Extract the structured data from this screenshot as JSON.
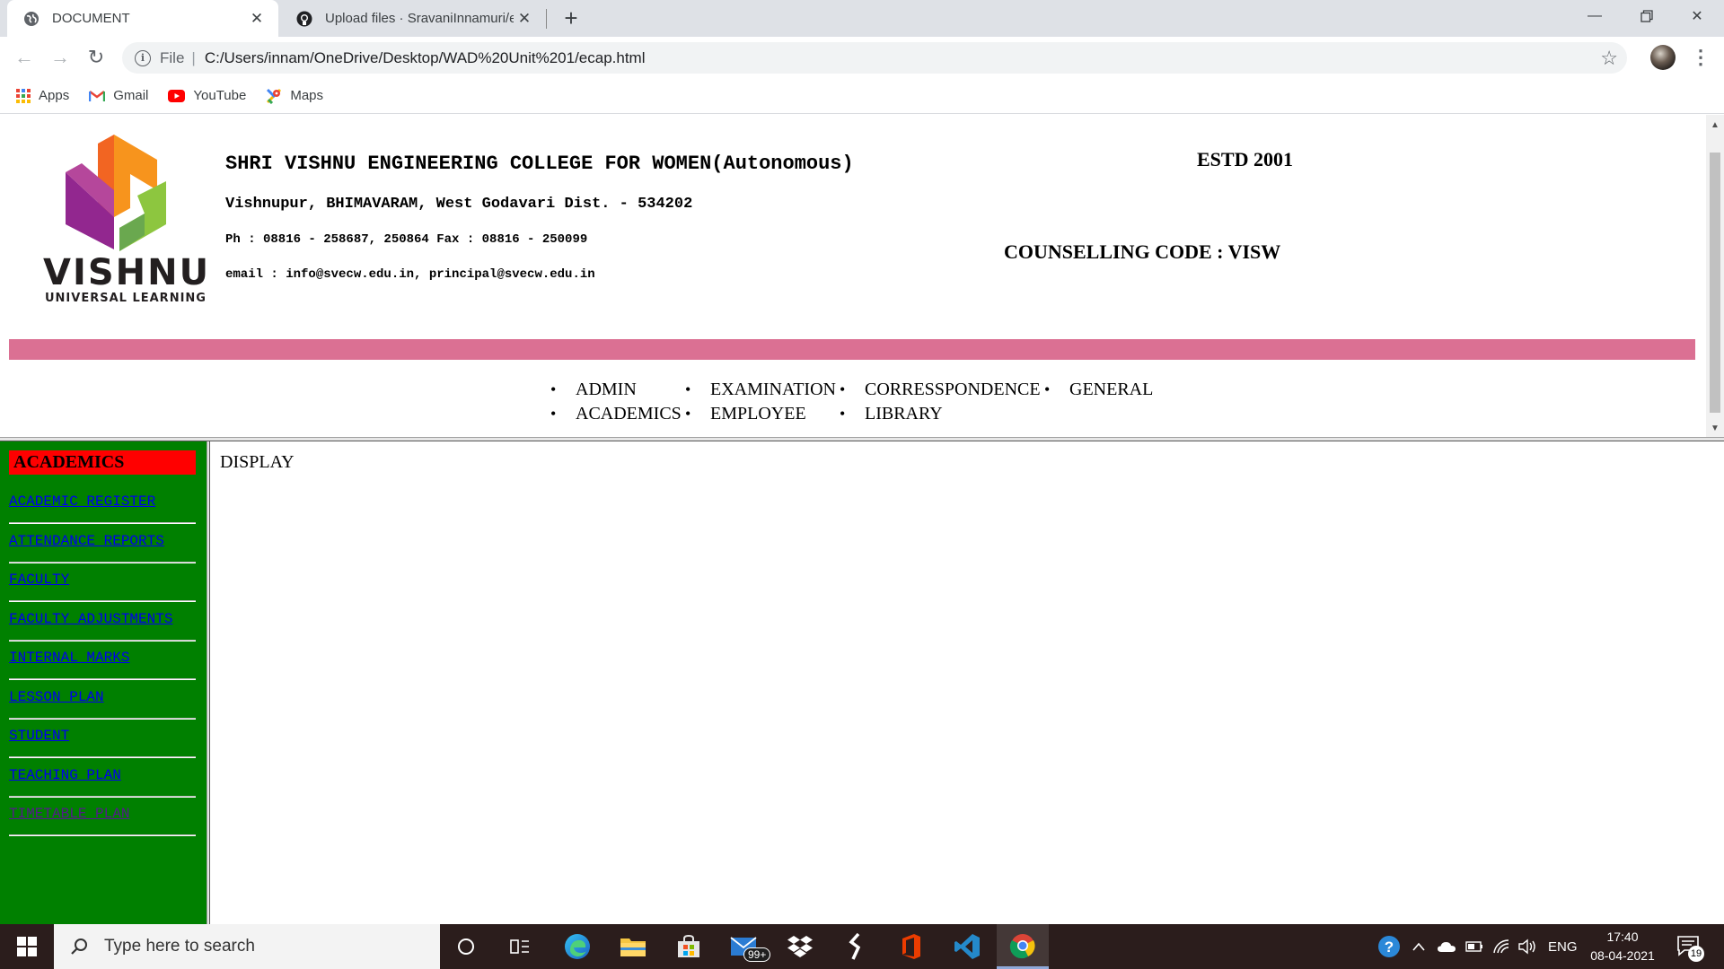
{
  "browser": {
    "tabs": [
      {
        "title": "DOCUMENT",
        "active": true
      },
      {
        "title": "Upload files · SravaniInnamuri/ec",
        "active": false
      }
    ],
    "address": {
      "scheme": "File",
      "url": "C:/Users/innam/OneDrive/Desktop/WAD%20Unit%201/ecap.html"
    },
    "bookmarks": [
      "Apps",
      "Gmail",
      "YouTube",
      "Maps"
    ]
  },
  "header": {
    "logo_word": "VISHNU",
    "logo_sub": "UNIVERSAL LEARNING",
    "college_name": "SHRI VISHNU ENGINEERING COLLEGE FOR WOMEN(Autonomous)",
    "address": "Vishnupur, BHIMAVARAM, West Godavari Dist. - 534202",
    "phone": "Ph : 08816 - 258687, 250864 Fax : 08816 - 250099",
    "email": "email : info@svecw.edu.in, principal@svecw.edu.in",
    "estd": "ESTD 2001",
    "counselling_code": "COUNSELLING CODE : VISW",
    "band_color": "#db7093"
  },
  "menu": {
    "items": [
      "ADMIN",
      "EXAMINATION",
      "CORRESSPONDENCE",
      "GENERAL",
      "ACADEMICS",
      "EMPLOYEE",
      "LIBRARY"
    ]
  },
  "sidebar": {
    "heading": "ACADEMICS",
    "background": "#008000",
    "heading_bg": "#ff0000",
    "links": [
      {
        "label": "ACADEMIC REGISTER",
        "visited": false
      },
      {
        "label": "ATTENDANCE REPORTS",
        "visited": false
      },
      {
        "label": "FACULTY",
        "visited": false
      },
      {
        "label": "FACULTY ADJUSTMENTS",
        "visited": false
      },
      {
        "label": "INTERNAL MARKS",
        "visited": false
      },
      {
        "label": "LESSON PLAN",
        "visited": false
      },
      {
        "label": "STUDENT",
        "visited": false
      },
      {
        "label": "TEACHING PLAN",
        "visited": false
      },
      {
        "label": "TIMETABLE PLAN",
        "visited": true
      }
    ]
  },
  "main": {
    "display_text": "DISPLAY"
  },
  "taskbar": {
    "search_placeholder": "Type here to search",
    "mail_badge": "99+",
    "language": "ENG",
    "time": "17:40",
    "date": "08-04-2021",
    "notification_count": "19"
  }
}
